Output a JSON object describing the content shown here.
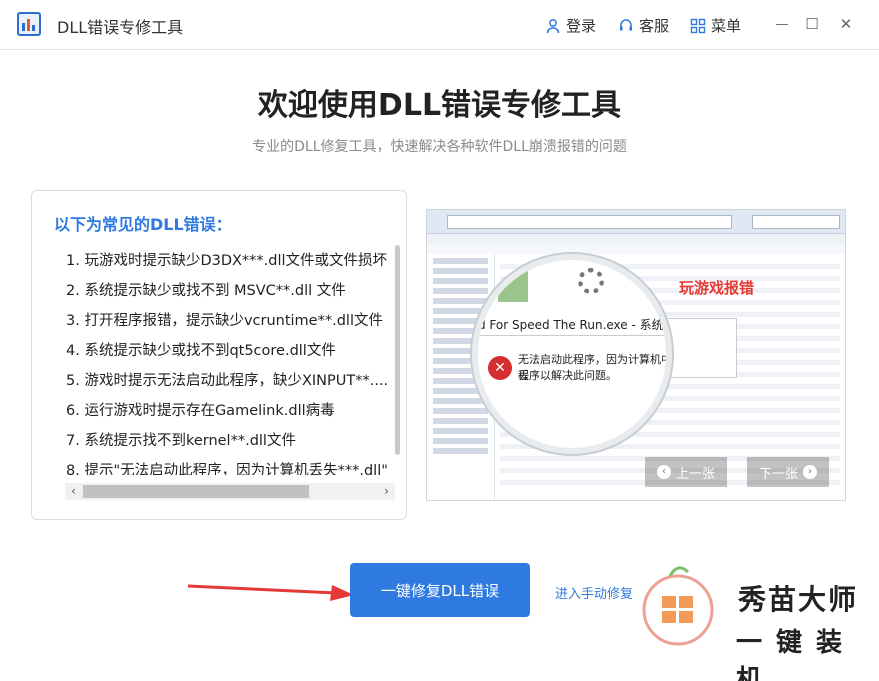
{
  "titlebar": {
    "app_title": "DLL错误专修工具",
    "login_label": "登录",
    "service_label": "客服",
    "menu_label": "菜单",
    "minimize_glyph": "—",
    "maximize_glyph": "☐",
    "close_glyph": "✕"
  },
  "header": {
    "title": "欢迎使用DLL错误专修工具",
    "subtitle": "专业的DLL修复工具，快速解决各种软件DLL崩溃报错的问题"
  },
  "error_card": {
    "title": "以下为常见的DLL错误：",
    "items": [
      "1. 玩游戏时提示缺少D3DX***.dll文件或文件损坏",
      "2. 系统提示缺少或找不到 MSVC**.dll 文件",
      "3. 打开程序报错，提示缺少vcruntime**.dll文件",
      "4. 系统提示缺少或找不到qt5core.dll文件",
      "5. 游戏时提示无法启动此程序，缺少XINPUT**....",
      "6. 运行游戏时提示存在Gamelink.dll病毒",
      "7. 系统提示找不到kernel**.dll文件",
      "8. 提示\"无法启动此程序，因为计算机丢失***.dll\""
    ],
    "scroll_left": "‹",
    "scroll_right": "›"
  },
  "preview": {
    "caption": "玩游戏报错",
    "dialog_title": "d For Speed The Run.exe - 系统错误",
    "error_line1": "无法启动此程序，因为计算机中丢",
    "error_line2": "程序以解决此问题。",
    "error_glyph": "✕",
    "prev_label": "上一张",
    "next_label": "下一张",
    "prev_glyph": "‹",
    "next_glyph": "›"
  },
  "actions": {
    "primary_label": "一键修复DLL错误",
    "manual_label": "进入手动修复"
  },
  "watermark": {
    "line1": "秀苗大师",
    "line2": "一键装机"
  },
  "colors": {
    "accent": "#2e7ae0",
    "error_red": "#e53935",
    "arrow_red": "#e53935"
  }
}
